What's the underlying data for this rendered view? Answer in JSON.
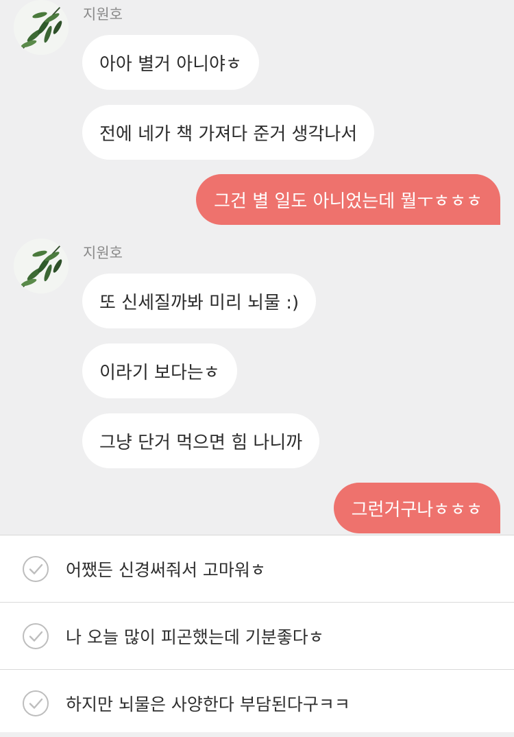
{
  "chat": {
    "groups": [
      {
        "sender": "지원호",
        "messages": [
          "아아 별거 아니야ㅎ",
          "전에 네가 책 가져다 준거 생각나서"
        ]
      },
      {
        "mine": [
          "그건 별 일도 아니었는데 뭘ㅜㅎㅎㅎ"
        ]
      },
      {
        "sender": "지원호",
        "messages": [
          "또 신세질까봐 미리 뇌물 :)",
          "이라기 보다는ㅎ",
          "그냥 단거 먹으면 힘 나니까"
        ]
      },
      {
        "mine": [
          "그런거구나ㅎㅎㅎ"
        ]
      }
    ]
  },
  "replies": [
    {
      "label": "어쨌든 신경써줘서 고마워ㅎ",
      "icon": "check-circle-icon"
    },
    {
      "label": "나 오늘 많이 피곤했는데 기분좋다ㅎ",
      "icon": "check-circle-icon"
    },
    {
      "label": "하지만 뇌물은 사양한다 부담된다구ㅋㅋ",
      "icon": "check-circle-icon"
    }
  ],
  "colors": {
    "background": "#efeff0",
    "incoming_bubble": "#ffffff",
    "outgoing_bubble": "#ee726d",
    "reply_panel": "#ffffff"
  }
}
